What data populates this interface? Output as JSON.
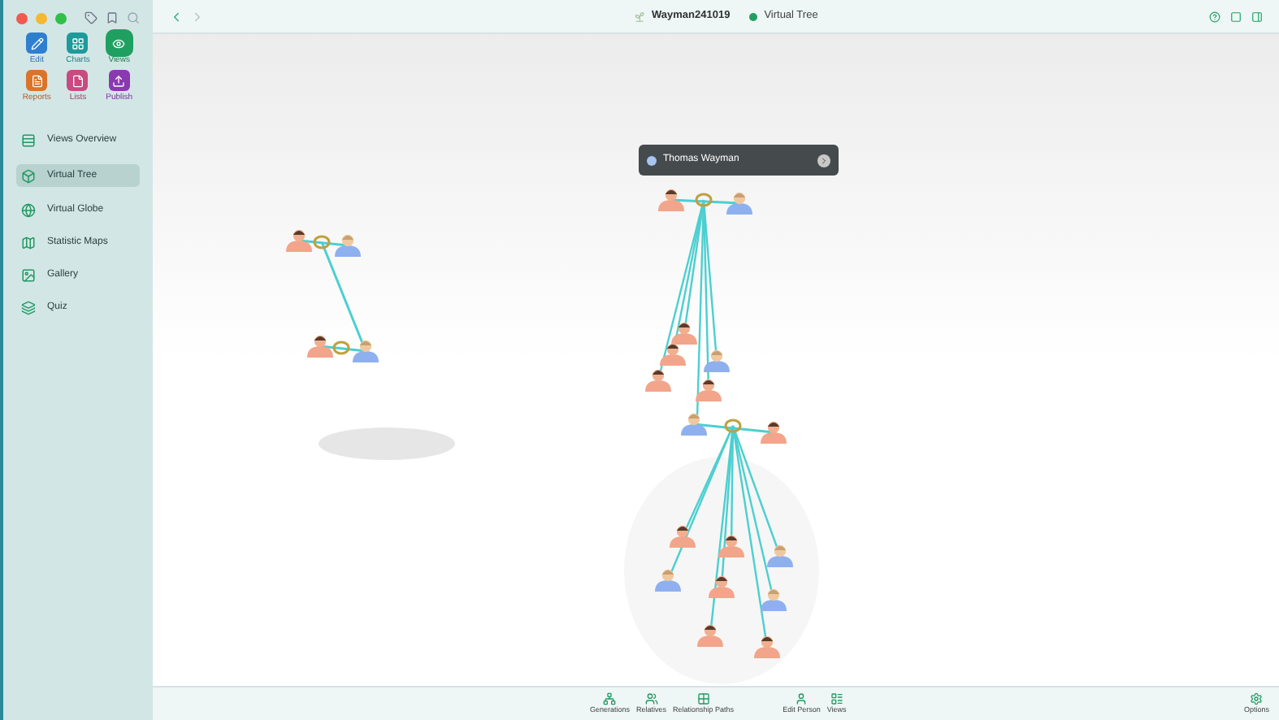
{
  "app_tiles": [
    {
      "label": "Edit",
      "kind": "edit",
      "selected": false
    },
    {
      "label": "Charts",
      "kind": "charts",
      "selected": false
    },
    {
      "label": "Views",
      "kind": "views",
      "selected": true
    },
    {
      "label": "Reports",
      "kind": "reports",
      "selected": false
    },
    {
      "label": "Lists",
      "kind": "lists",
      "selected": false
    },
    {
      "label": "Publish",
      "kind": "publish",
      "selected": false
    }
  ],
  "sidebar": {
    "items": [
      {
        "label": "Views Overview",
        "kind": "overview",
        "selected": false
      },
      {
        "label": "Virtual Tree",
        "kind": "tree",
        "selected": true
      },
      {
        "label": "Virtual Globe",
        "kind": "globe",
        "selected": false
      },
      {
        "label": "Statistic Maps",
        "kind": "maps",
        "selected": false
      },
      {
        "label": "Gallery",
        "kind": "gallery",
        "selected": false
      },
      {
        "label": "Quiz",
        "kind": "quiz",
        "selected": false
      }
    ]
  },
  "title": {
    "document": "Wayman241019",
    "view": "Virtual Tree"
  },
  "selection_popup": {
    "name": "Thomas Wayman"
  },
  "bottom_bar": {
    "buttons": [
      {
        "label": "Generations",
        "kind": "generations"
      },
      {
        "label": "Relatives",
        "kind": "relatives"
      },
      {
        "label": "Relationship Paths",
        "kind": "paths"
      },
      {
        "label": "Edit Person",
        "kind": "person"
      },
      {
        "label": "Views",
        "kind": "views"
      }
    ],
    "options": {
      "label": "Options"
    }
  }
}
